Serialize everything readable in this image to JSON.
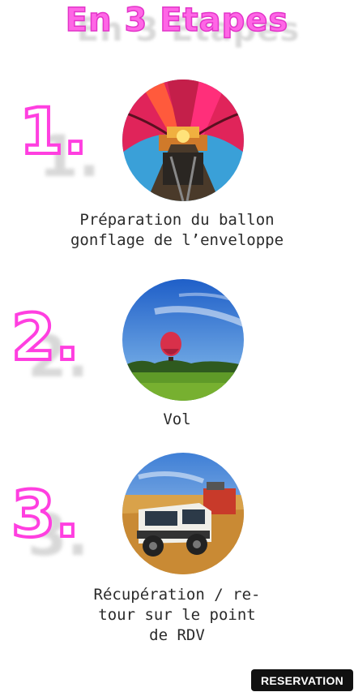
{
  "header": {
    "title": "En 3 Etapes"
  },
  "steps": [
    {
      "number": "1.",
      "caption_line1": "Préparation du ballon",
      "caption_line2": "gonflage de l’enveloppe",
      "image": "balloon-inflation-photo"
    },
    {
      "number": "2.",
      "caption_line1": "Vol",
      "image": "balloon-flight-photo"
    },
    {
      "number": "3.",
      "caption_line1": "Récupération / re-",
      "caption_line2": "tour sur le point",
      "caption_line3": "de RDV",
      "image": "land-rover-recovery-photo"
    }
  ],
  "actions": {
    "reservation_label": "RESERVATION"
  },
  "colors": {
    "accent_pink": "#ff3fe0",
    "text": "#2b2b2b",
    "button_bg": "#111111"
  }
}
